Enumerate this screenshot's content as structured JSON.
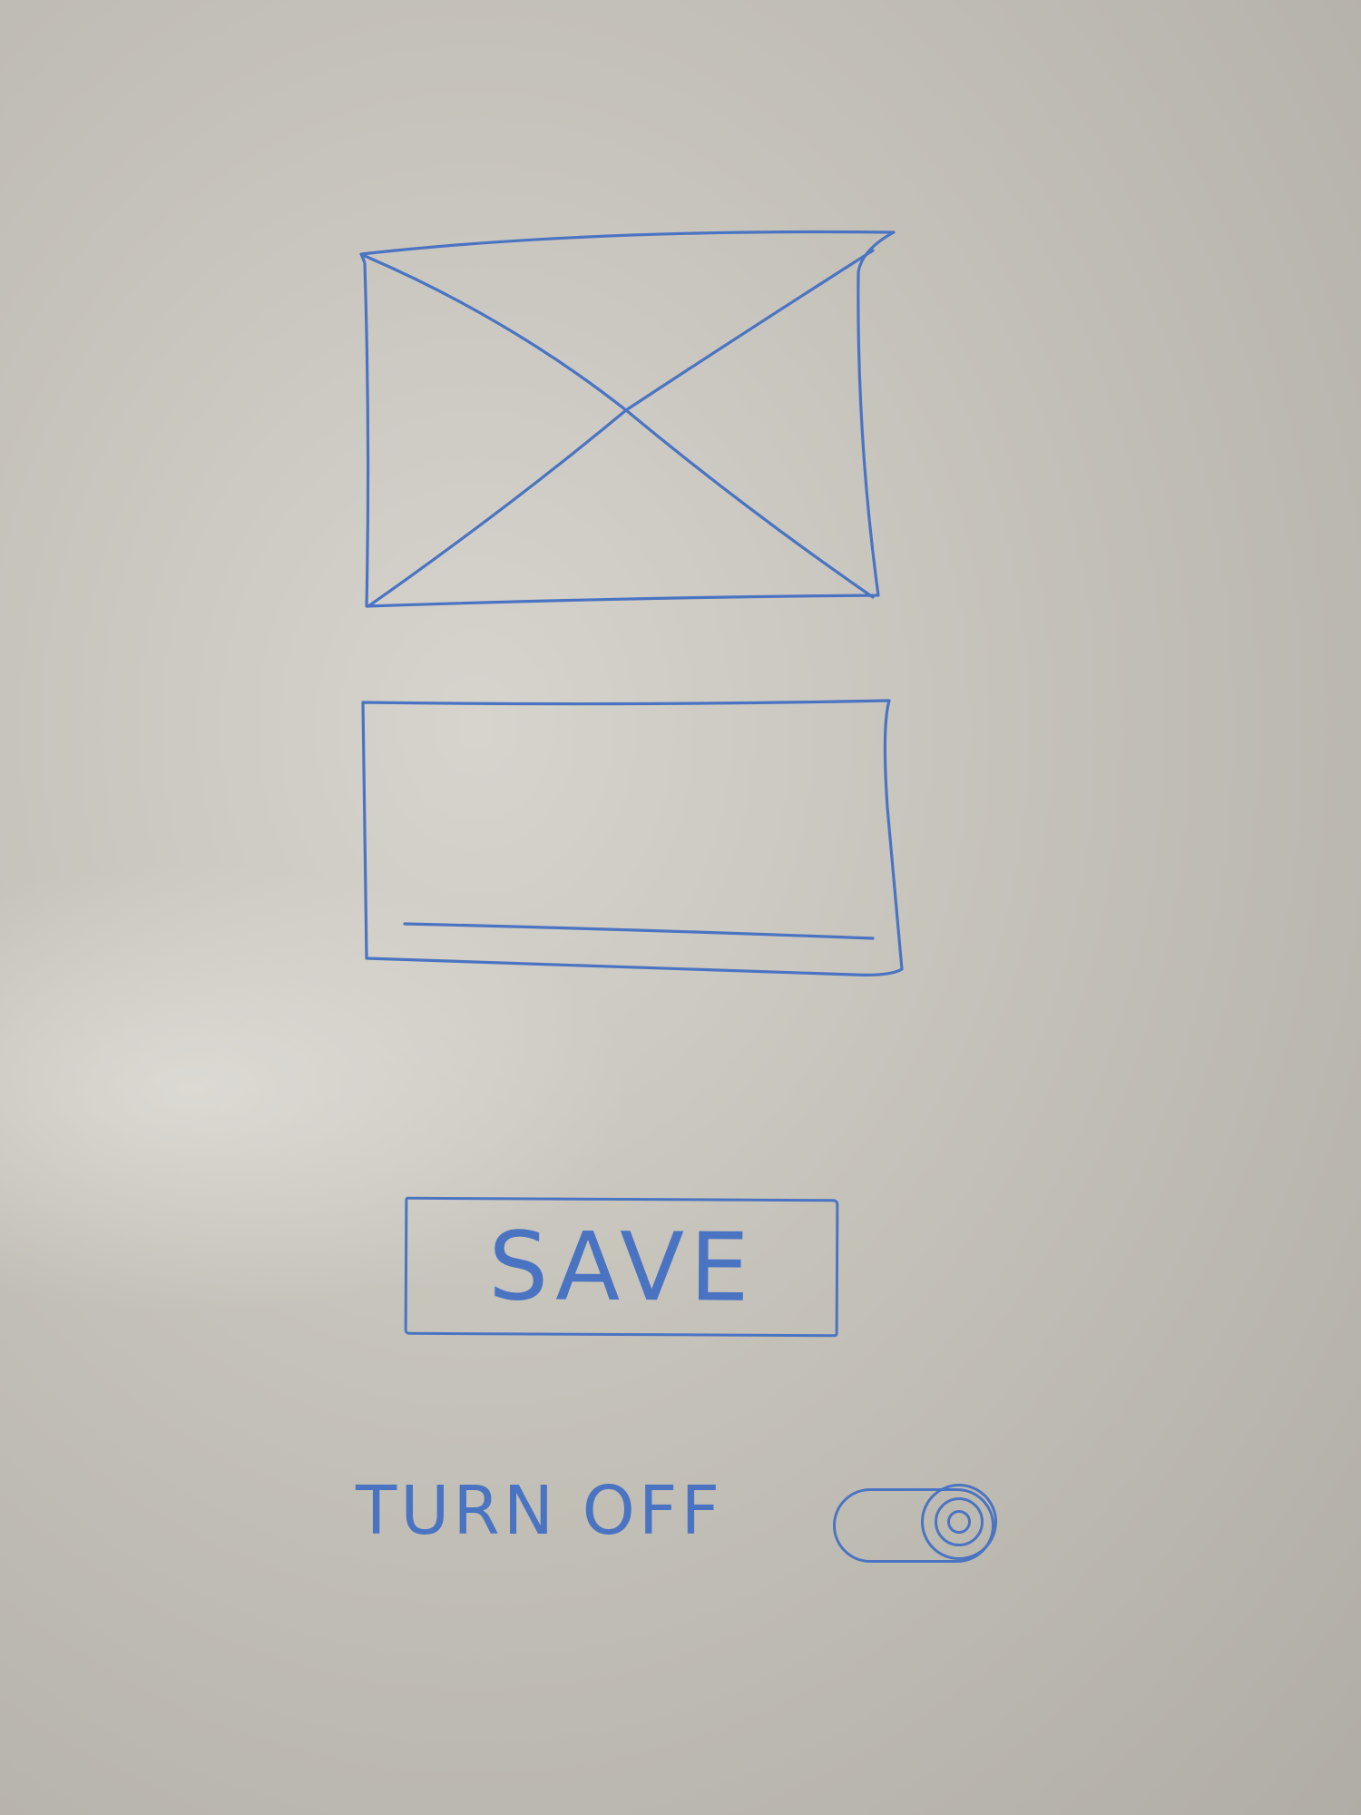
{
  "colors": {
    "ink": "#4a74c2",
    "board": "#c4c1b9"
  },
  "image_placeholder": {
    "icon": "image-placeholder-icon"
  },
  "text_area": {
    "icon": "text-input-placeholder"
  },
  "save_button": {
    "label": "SAVE"
  },
  "toggle": {
    "label": "TURN OFF",
    "state": "on",
    "icon": "toggle-switch-icon"
  }
}
